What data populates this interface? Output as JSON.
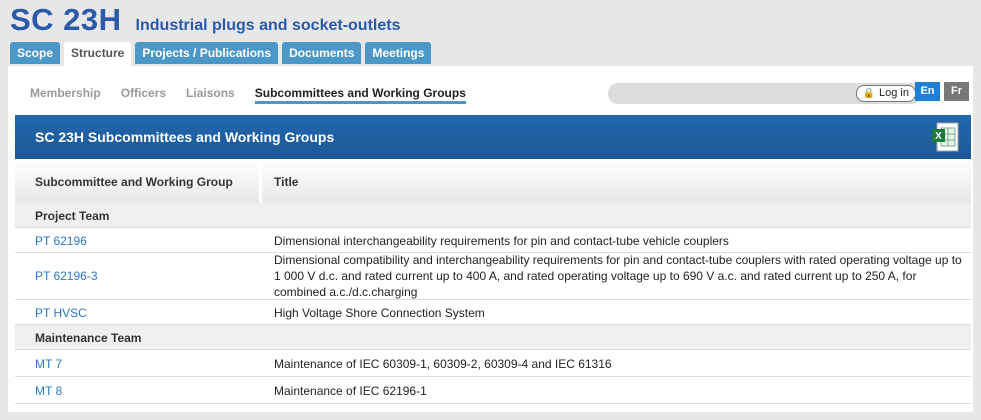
{
  "header": {
    "code": "SC 23H",
    "name": "Industrial plugs and socket-outlets"
  },
  "tabs": [
    {
      "label": "Scope",
      "active": false
    },
    {
      "label": "Structure",
      "active": true
    },
    {
      "label": "Projects / Publications",
      "active": false
    },
    {
      "label": "Documents",
      "active": false
    },
    {
      "label": "Meetings",
      "active": false
    }
  ],
  "subnav": [
    {
      "label": "Membership"
    },
    {
      "label": "Officers"
    },
    {
      "label": "Liaisons"
    },
    {
      "label": "Subcommittees and Working Groups"
    }
  ],
  "login": {
    "label": "Log in"
  },
  "lang": {
    "en": "En",
    "fr": "Fr"
  },
  "section_title": "SC 23H Subcommittees and Working Groups",
  "table": {
    "headers": [
      "Subcommittee and Working Group",
      "Title"
    ],
    "groups": [
      {
        "name": "Project Team",
        "rows": [
          {
            "id": "PT 62196",
            "title": "Dimensional interchangeability requirements for pin and contact-tube vehicle couplers"
          },
          {
            "id": "PT 62196-3",
            "title": "Dimensional compatibility and interchangeability requirements for pin and contact-tube couplers with rated operating voltage up to 1 000 V d.c. and rated current up to 400 A, and rated operating voltage up to 690 V a.c. and rated current up to 250 A, for combined a.c./d.c.charging"
          },
          {
            "id": "PT HVSC",
            "title": "High Voltage Shore Connection System"
          }
        ]
      },
      {
        "name": "Maintenance Team",
        "rows": [
          {
            "id": "MT 7",
            "title": "Maintenance of IEC 60309-1, 60309-2, 60309-4 and IEC 61316"
          },
          {
            "id": "MT 8",
            "title": "Maintenance of IEC 62196-1"
          }
        ]
      }
    ]
  }
}
